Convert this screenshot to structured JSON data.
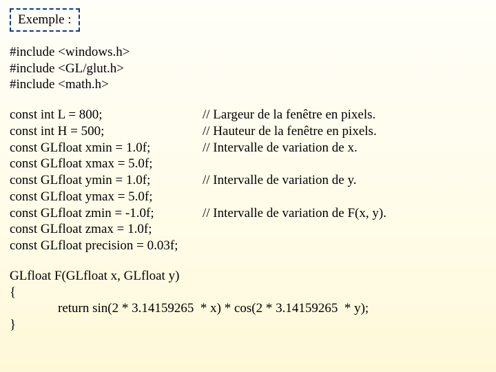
{
  "title": "Exemple :",
  "includes": [
    "#include <windows.h>",
    "#include <GL/glut.h>",
    "#include <math.h>"
  ],
  "consts": [
    {
      "decl": "const int L = 800;",
      "comment": "// Largeur de la fenêtre en pixels."
    },
    {
      "decl": "const int H = 500;",
      "comment": "// Hauteur de la fenêtre en pixels."
    },
    {
      "decl": "const GLfloat xmin = 1.0f;",
      "comment": "// Intervalle de variation de x."
    },
    {
      "decl": "const GLfloat xmax = 5.0f;",
      "comment": ""
    },
    {
      "decl": "const GLfloat ymin = 1.0f;",
      "comment": "// Intervalle de variation de y."
    },
    {
      "decl": "const GLfloat ymax = 5.0f;",
      "comment": ""
    },
    {
      "decl": "const GLfloat zmin = -1.0f;",
      "comment": "// Intervalle de variation de F(x, y)."
    },
    {
      "decl": "const GLfloat zmax = 1.0f;",
      "comment": ""
    },
    {
      "decl": "const GLfloat precision = 0.03f;",
      "comment": ""
    }
  ],
  "fn": {
    "sig": "GLfloat F(GLfloat x, GLfloat y)",
    "open": "{",
    "body": "return sin(2 * 3.14159265  * x) * cos(2 * 3.14159265  * y);",
    "close": "}"
  }
}
